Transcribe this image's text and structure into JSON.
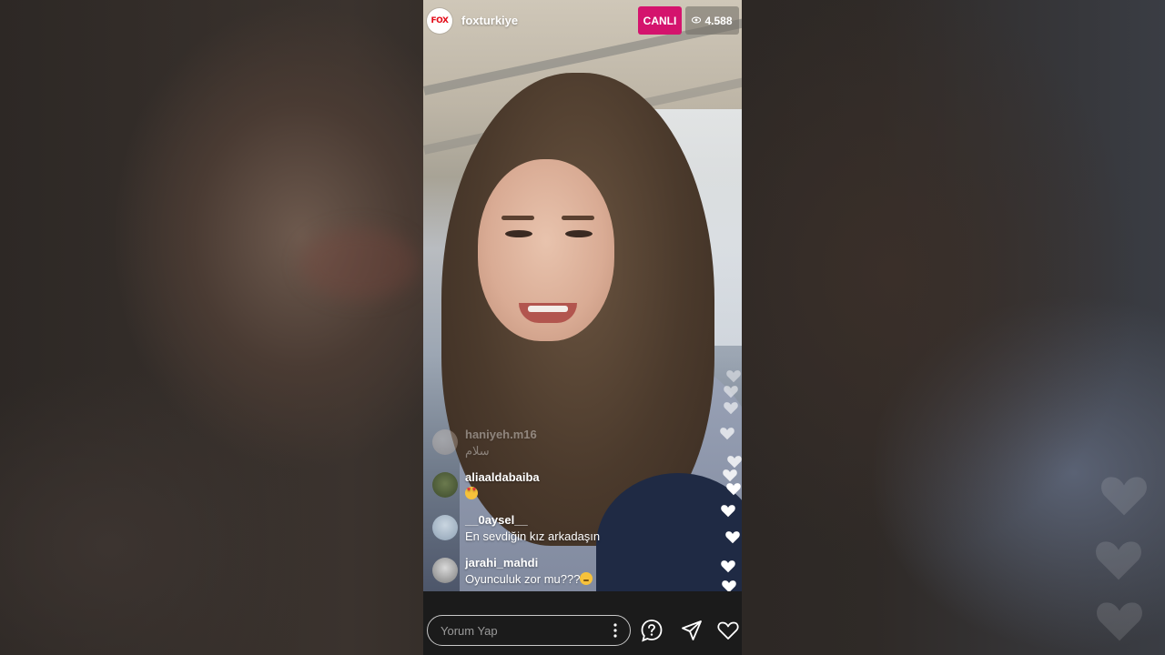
{
  "broadcast": {
    "account": "foxturkiye",
    "avatar_logo_text": "FOX",
    "live_label": "CANLI",
    "viewer_count": "4.588"
  },
  "comments": [
    {
      "username": "haniyeh.m16",
      "text": "سلام",
      "faded": true
    },
    {
      "username": "aliaaldabaiba",
      "text": "",
      "emoji": "heart-eyes-emoji"
    },
    {
      "username": "__0aysel__",
      "text": "En sevdiğin kız arkadaşın"
    },
    {
      "username": "jarahi_mahdi",
      "text": "Oyunculuk zor mu???",
      "emoji": "thinking-face-emoji"
    }
  ],
  "composer": {
    "placeholder": "Yorum Yap"
  },
  "icons": {
    "question": "question-icon",
    "share": "send-icon",
    "like": "heart-icon",
    "options": "more-vertical-icon",
    "views": "eye-icon"
  },
  "colors": {
    "live_badge": "#d4136d",
    "fox_red": "#e30a17",
    "bottom_bar": "#1b1b1b"
  }
}
